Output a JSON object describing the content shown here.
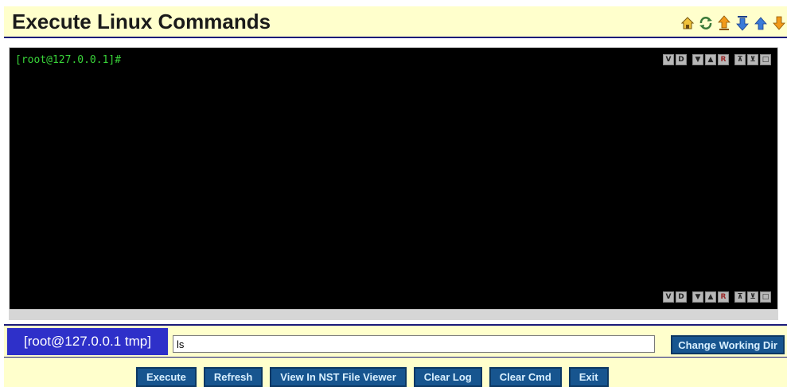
{
  "header": {
    "title": "Execute Linux Commands",
    "nav_icons": [
      "home-icon",
      "refresh-icon",
      "arrow-up-top-icon",
      "arrow-down-bottom-icon",
      "arrow-up-icon",
      "arrow-down-icon"
    ]
  },
  "terminal": {
    "prompt": "[root@127.0.0.1]#",
    "controls": [
      "V",
      "D",
      "▼",
      "▲",
      "R",
      "⊼",
      "⊻",
      "□"
    ]
  },
  "command": {
    "cwd_label": "[root@127.0.0.1 tmp]",
    "input_value": "ls",
    "change_dir_label": "Change Working Dir"
  },
  "actions": {
    "execute": "Execute",
    "refresh": "Refresh",
    "view_nst": "View In NST File Viewer",
    "clear_log": "Clear Log",
    "clear_cmd": "Clear Cmd",
    "exit": "Exit"
  },
  "colors": {
    "title_bg": "#ffffcc",
    "terminal_bg": "#000000",
    "prompt_text": "#39d439",
    "cwd_bg": "#2e30c9",
    "button_bg": "#17558f"
  }
}
